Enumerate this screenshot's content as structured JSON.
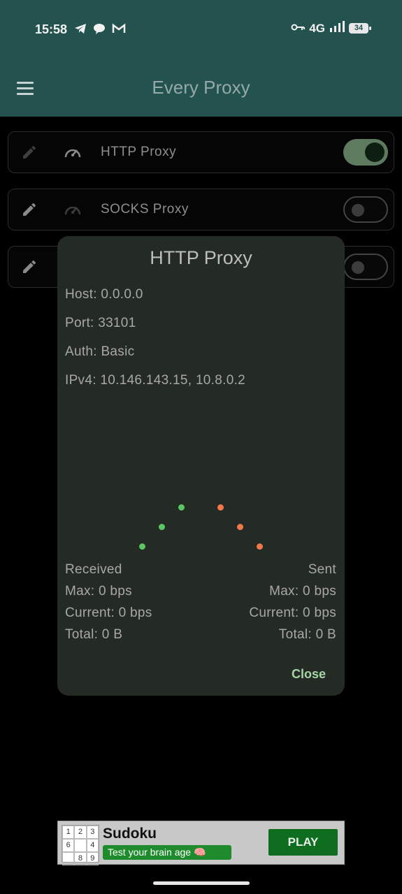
{
  "status_bar": {
    "time": "15:58",
    "network": "4G",
    "battery": "34",
    "icons": [
      "telegram-icon",
      "chat-bubble-icon",
      "gmail-icon",
      "vpn-key-icon",
      "signal-icon"
    ]
  },
  "app_bar": {
    "title": "Every Proxy",
    "menu_icon": "hamburger-menu-icon"
  },
  "proxy_list": [
    {
      "label": "HTTP Proxy",
      "enabled": true
    },
    {
      "label": "SOCKS Proxy",
      "enabled": false
    },
    {
      "label": "",
      "enabled": false
    }
  ],
  "dialog": {
    "title": "HTTP Proxy",
    "host": "Host: 0.0.0.0",
    "port": "Port: 33101",
    "auth": "Auth: Basic",
    "ipv4": "IPv4: 10.146.143.15, 10.8.0.2",
    "received": {
      "label": "Received",
      "max": "Max: 0 bps",
      "current": "Current: 0 bps",
      "total": "Total: 0 B"
    },
    "sent": {
      "label": "Sent",
      "max": "Max: 0 bps",
      "current": "Current: 0 bps",
      "total": "Total: 0 B"
    },
    "close_label": "Close"
  },
  "ad": {
    "title": "Sudoku",
    "subtitle": "Test your brain age 🧠",
    "cta": "PLAY",
    "grid": [
      "1",
      "2",
      "3",
      "6",
      "",
      "4",
      "",
      "8",
      "9"
    ]
  },
  "colors": {
    "app_bar": "#24534f",
    "dialog_bg": "#242a24",
    "accent_green": "#a5d6a7",
    "received_dot": "#5cc462",
    "sent_dot": "#f2784b"
  }
}
